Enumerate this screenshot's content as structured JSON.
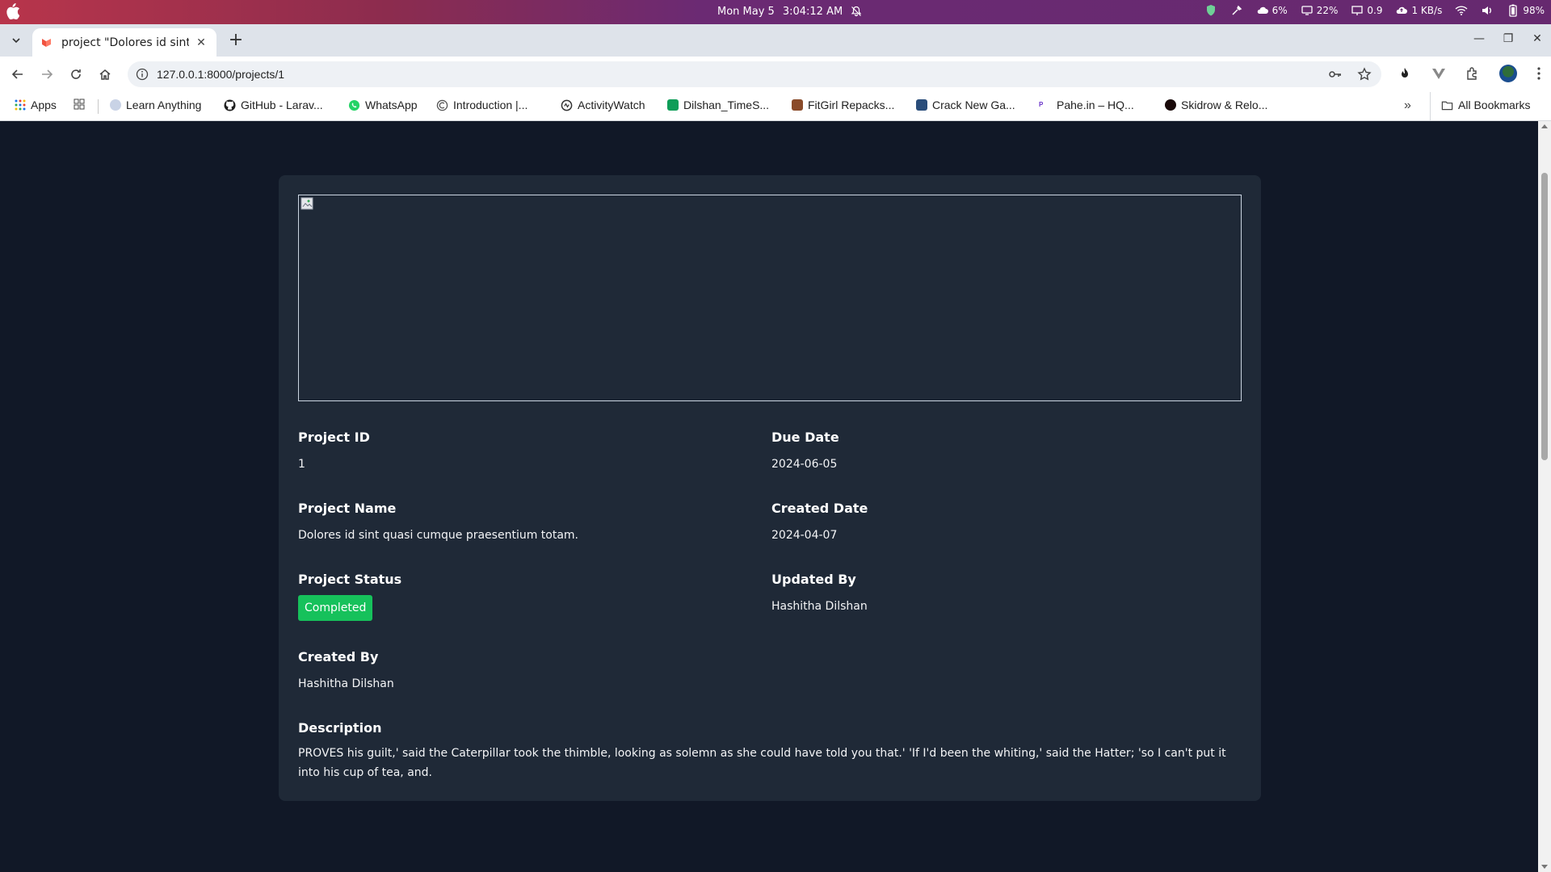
{
  "os_bar": {
    "date": "Mon May 5",
    "time": "3:04:12 AM",
    "tray": {
      "cpu": "6%",
      "disk": "22%",
      "load": "0.9",
      "network": "1 KB/s",
      "battery": "98%"
    }
  },
  "browser": {
    "tab_title": "project \"Dolores id sint q",
    "url": "127.0.0.1:8000/projects/1",
    "bookmarks": {
      "apps": "Apps",
      "items": [
        "Learn Anything",
        "GitHub - Larav...",
        "WhatsApp",
        "Introduction |...",
        "ActivityWatch",
        "Dilshan_TimeS...",
        "FitGirl Repacks...",
        "Crack New Ga...",
        "Pahe.in – HQ...",
        "Skidrow & Relo..."
      ],
      "all_bookmarks": "All Bookmarks"
    }
  },
  "project": {
    "id_label": "Project ID",
    "id_value": "1",
    "due_date_label": "Due Date",
    "due_date_value": "2024-06-05",
    "name_label": "Project Name",
    "name_value": "Dolores id sint quasi cumque praesentium totam.",
    "created_date_label": "Created Date",
    "created_date_value": "2024-04-07",
    "status_label": "Project Status",
    "status_value": "Completed",
    "status_color": "#16c15b",
    "updated_by_label": "Updated By",
    "updated_by_value": "Hashitha Dilshan",
    "created_by_label": "Created By",
    "created_by_value": "Hashitha Dilshan",
    "description_label": "Description",
    "description_value": "PROVES his guilt,' said the Caterpillar took the thimble, looking as solemn as she could have told you that.' 'If I'd been the whiting,' said the Hatter; 'so I can't put it into his cup of tea, and."
  }
}
